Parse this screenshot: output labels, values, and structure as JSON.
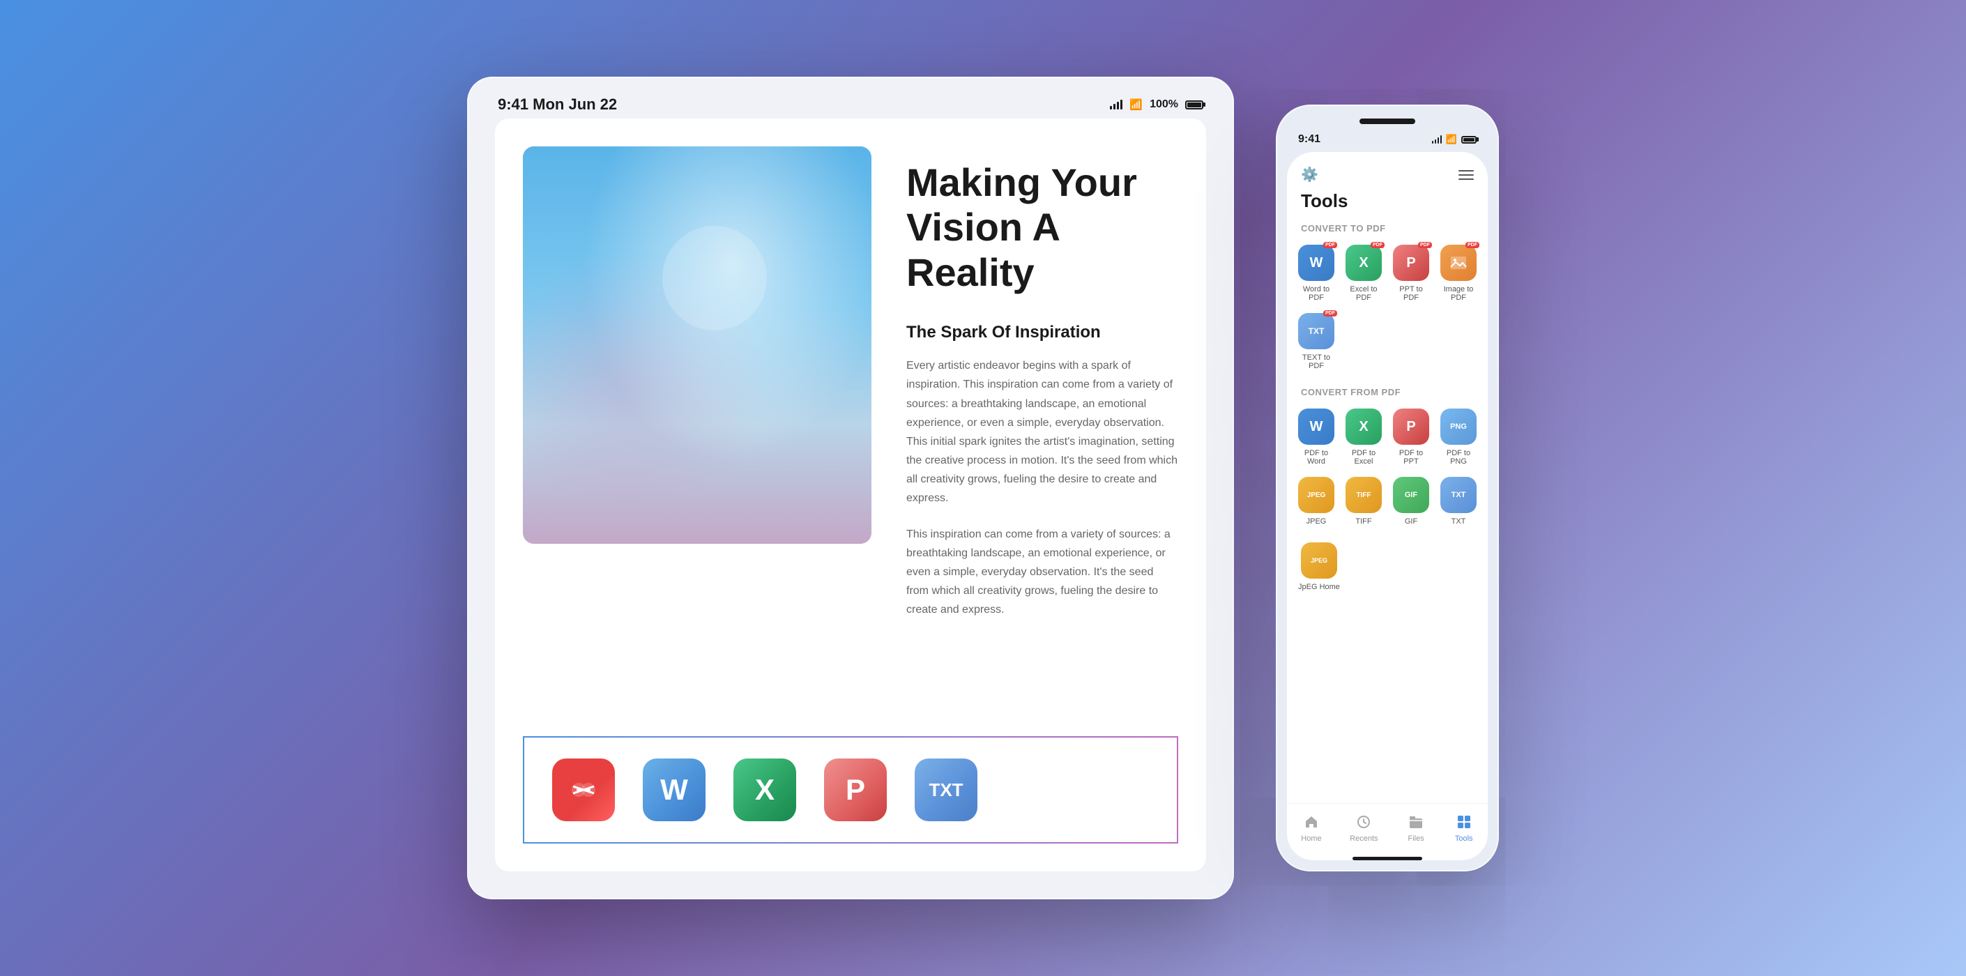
{
  "background": {
    "gradient": "linear-gradient(135deg, #4a90e2 0%, #7b5ea7 50%, #a8c8f8 100%)"
  },
  "ipad": {
    "status_bar": {
      "time": "9:41  Mon Jun 22",
      "battery": "100%",
      "signal": "●●●",
      "wifi": "wifi"
    },
    "content": {
      "main_title_line1": "Making Your",
      "main_title_line2": "Vision A Reality",
      "section_title": "The Spark Of Inspiration",
      "section_body_1": "Every artistic endeavor begins with a spark of inspiration. This inspiration can come from a variety of sources: a breathtaking landscape, an emotional experience, or even a simple, everyday observation. This initial spark ignites the artist's imagination, setting the creative process in motion. It's the seed from which all creativity grows, fueling the desire to create and express.",
      "section_body_2": "This inspiration can come from a variety of sources: a breathtaking landscape, an emotional experience, or even a simple, everyday observation. It's the seed from which all creativity grows, fueling the desire to create and express."
    },
    "toolbar_icons": [
      {
        "icon": "merge",
        "label": "✕"
      },
      {
        "icon": "word",
        "label": "W"
      },
      {
        "icon": "excel",
        "label": "X"
      },
      {
        "icon": "ppt",
        "label": "P"
      },
      {
        "icon": "txt",
        "label": "TXT"
      }
    ]
  },
  "iphone": {
    "status_bar": {
      "time": "9:41"
    },
    "page_title": "Tools",
    "convert_to_pdf_label": "CONVERT TO PDF",
    "convert_from_pdf_label": "CONVERT FROM PDF",
    "convert_to_tools": [
      {
        "icon": "word",
        "label": "Word to PDF",
        "letter": "W",
        "color": "sm-word"
      },
      {
        "icon": "excel",
        "label": "Excel to PDF",
        "letter": "X",
        "color": "sm-excel"
      },
      {
        "icon": "ppt",
        "label": "PPT to PDF",
        "letter": "P",
        "color": "sm-ppt"
      },
      {
        "icon": "image",
        "label": "Image to PDF",
        "letter": "🖼",
        "color": "sm-image"
      },
      {
        "icon": "txt",
        "label": "TEXT to PDF",
        "letter": "TXT",
        "color": "sm-txt"
      }
    ],
    "convert_from_tools": [
      {
        "icon": "pdf-word",
        "label": "PDF to Word",
        "letter": "W",
        "color": "sm-pdf-word"
      },
      {
        "icon": "pdf-excel",
        "label": "PDF to Excel",
        "letter": "X",
        "color": "sm-pdf-excel"
      },
      {
        "icon": "pdf-ppt",
        "label": "PDF to PPT",
        "letter": "P",
        "color": "sm-pdf-ppt"
      },
      {
        "icon": "pdf-png",
        "label": "PDF to PNG",
        "letter": "PNG",
        "color": "sm-pdf-png"
      },
      {
        "icon": "jpeg",
        "label": "JPEG",
        "letter": "JPEG",
        "color": "sm-jpeg"
      },
      {
        "icon": "tiff",
        "label": "TIFF",
        "letter": "TIFF",
        "color": "sm-tiff"
      },
      {
        "icon": "gif",
        "label": "GIF",
        "letter": "GIF",
        "color": "sm-gif"
      },
      {
        "icon": "txt2",
        "label": "TXT",
        "letter": "TXT",
        "color": "sm-txt2"
      }
    ],
    "nav": [
      {
        "id": "home",
        "label": "Home",
        "active": false
      },
      {
        "id": "recents",
        "label": "Recents",
        "active": false
      },
      {
        "id": "files",
        "label": "Files",
        "active": false
      },
      {
        "id": "tools",
        "label": "Tools",
        "active": true
      }
    ]
  }
}
